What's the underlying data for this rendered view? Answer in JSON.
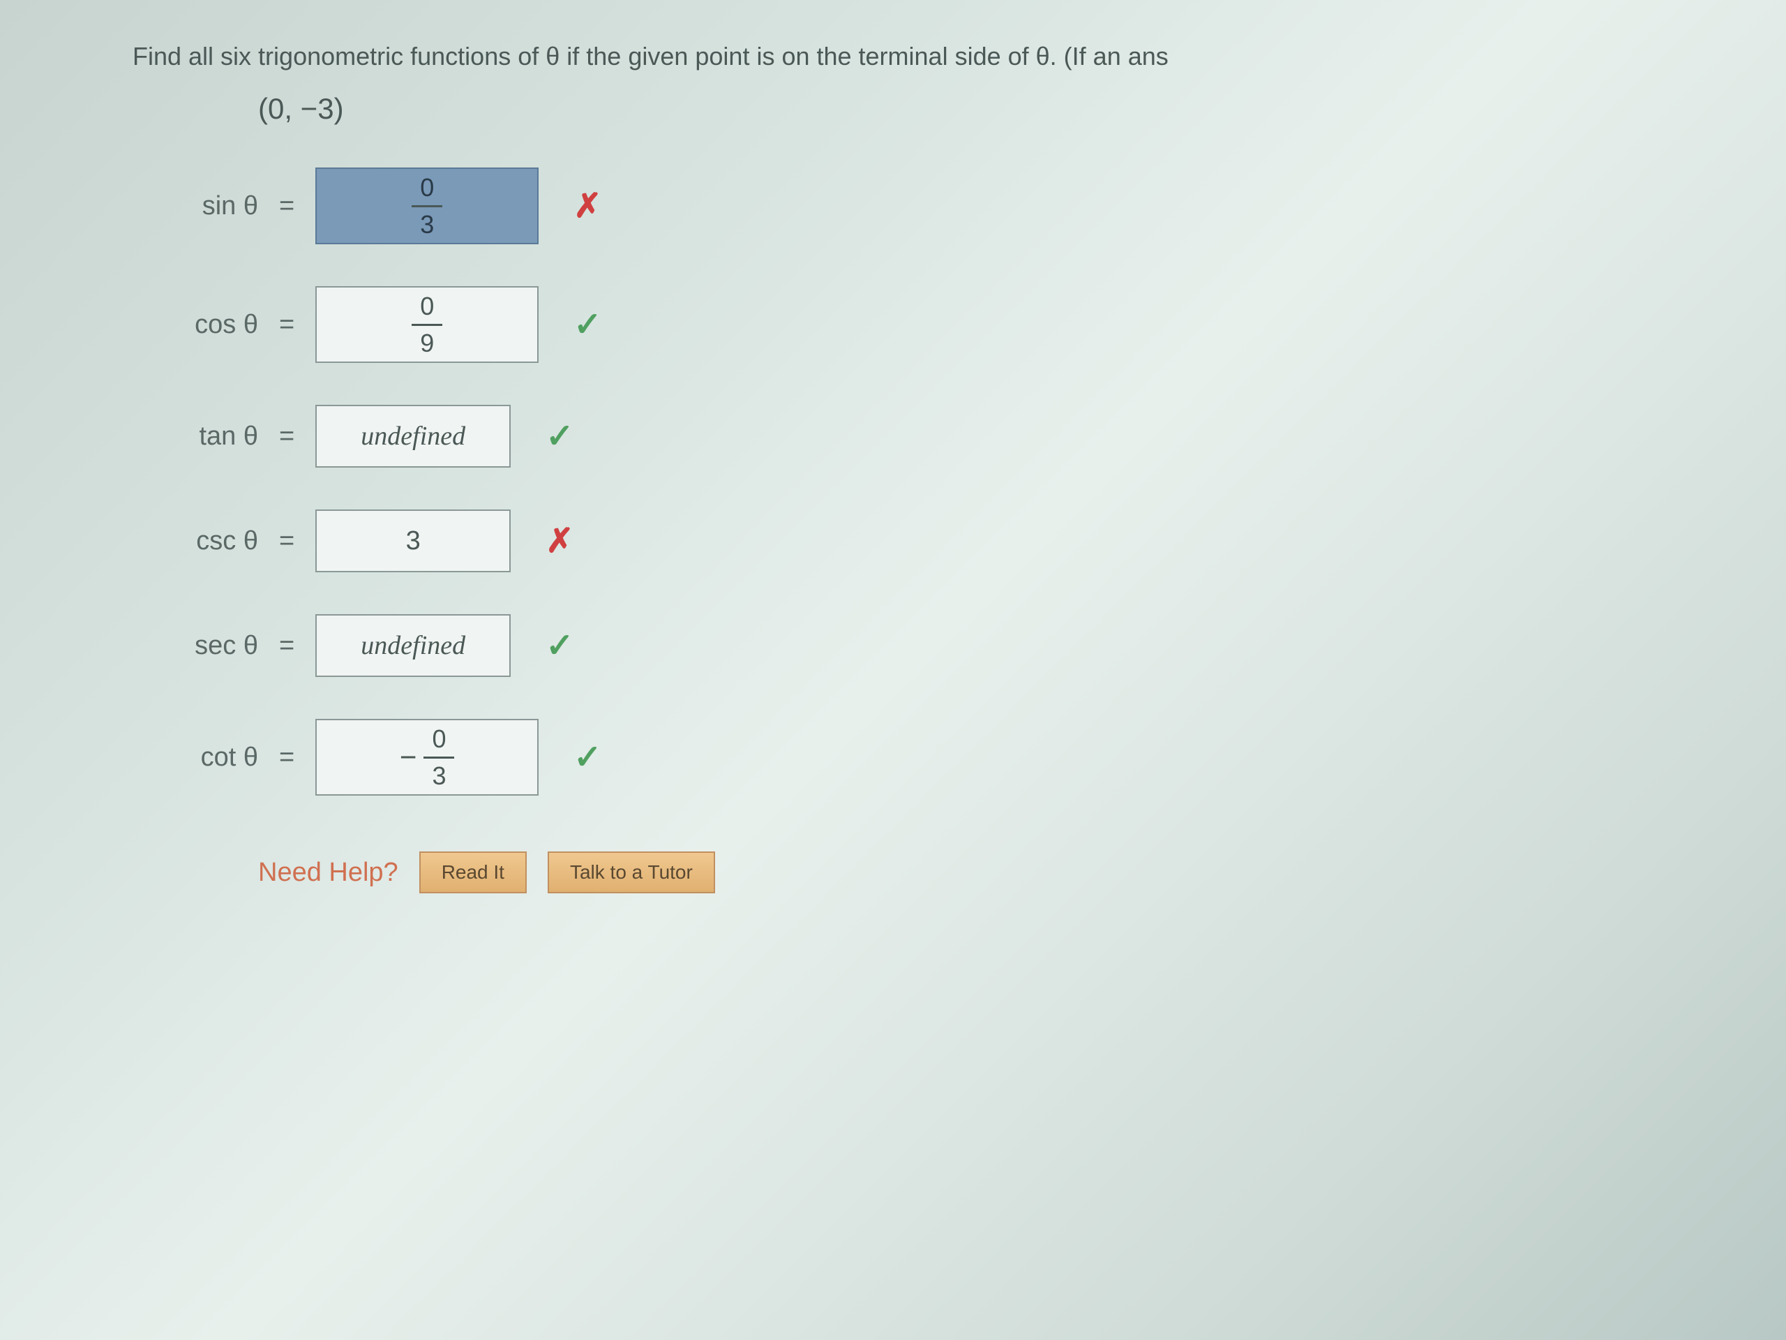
{
  "question": {
    "text": "Find all six trigonometric functions of θ if the given point is on the terminal side of θ. (If an ans",
    "point": "(0, −3)"
  },
  "answers": {
    "sin": {
      "label": "sin θ",
      "numerator": "0",
      "denominator": "3",
      "status": "incorrect",
      "highlighted": true
    },
    "cos": {
      "label": "cos θ",
      "numerator": "0",
      "denominator": "9",
      "status": "correct"
    },
    "tan": {
      "label": "tan θ",
      "value": "undefined",
      "status": "correct"
    },
    "csc": {
      "label": "csc θ",
      "value": "3",
      "status": "incorrect"
    },
    "sec": {
      "label": "sec θ",
      "value": "undefined",
      "status": "correct"
    },
    "cot": {
      "label": "cot θ",
      "negative": true,
      "numerator": "0",
      "denominator": "3",
      "status": "correct"
    }
  },
  "help": {
    "label": "Need Help?",
    "readButton": "Read It",
    "tutorButton": "Talk to a Tutor"
  },
  "icons": {
    "correct": "✓",
    "incorrect": "✗"
  }
}
